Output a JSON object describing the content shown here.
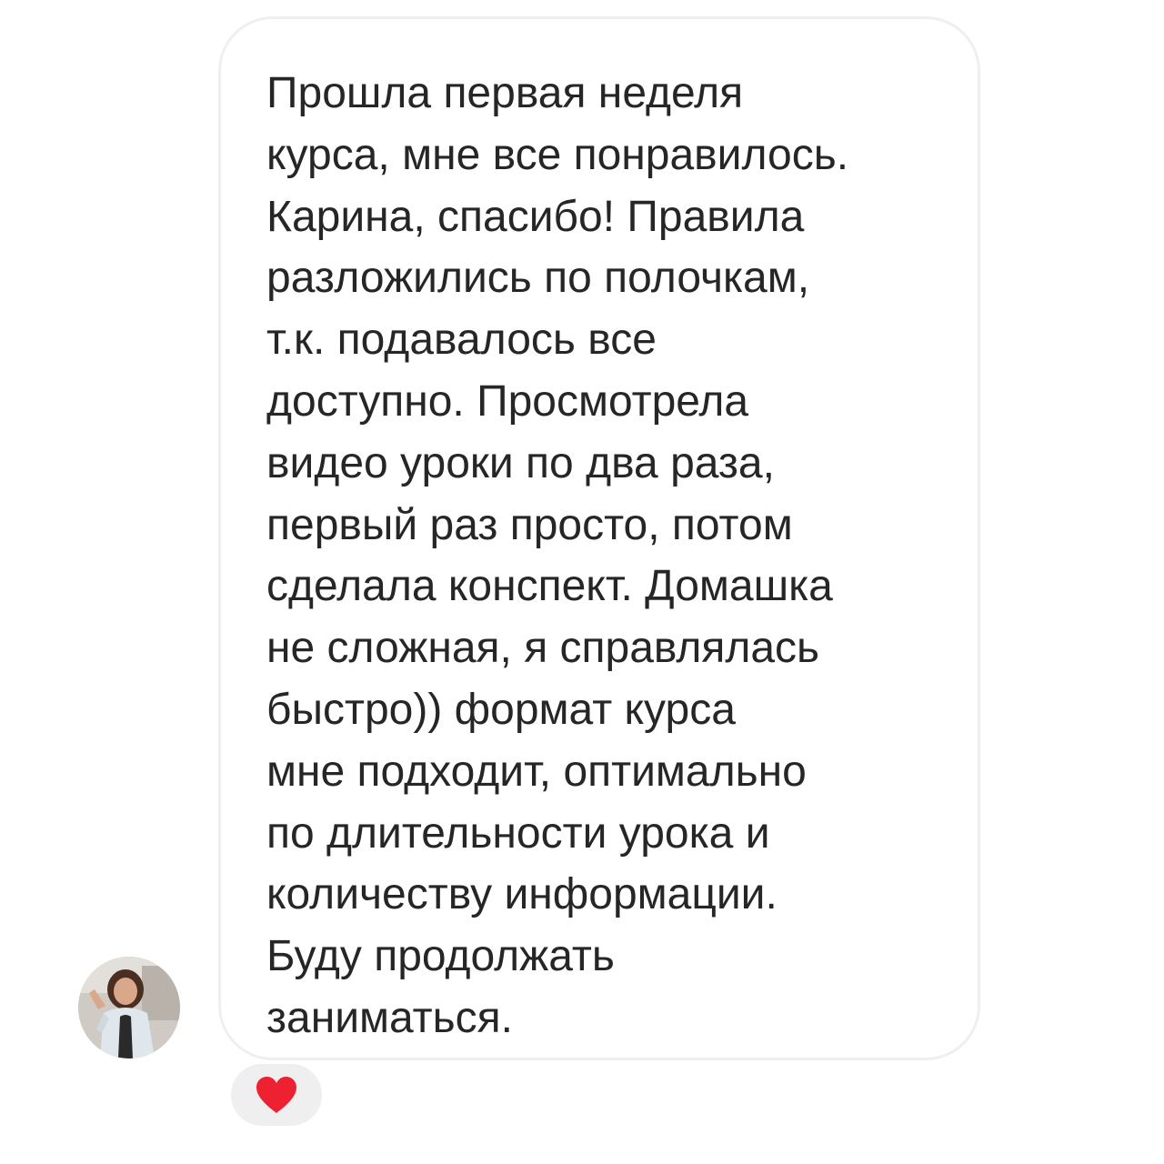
{
  "message": {
    "lines": [
      "Прошла первая неделя",
      "курса, мне все понравилось.",
      "Карина, спасибо! Правила",
      "разложились по полочкам,",
      "т.к. подавалось все",
      "доступно. Просмотрела",
      "видео уроки по два раза,",
      "первый раз просто, потом",
      "сделала конспект. Домашка",
      "не сложная, я справлялась",
      "быстро)) формат курса",
      "мне подходит, оптимально",
      "по длительности урока и",
      "количеству информации.",
      "Буду продолжать",
      "заниматься."
    ]
  },
  "sender": {
    "avatar_icon": "user-avatar-photo"
  },
  "reaction": {
    "icon": "heart-icon",
    "color": "#ed2131"
  },
  "colors": {
    "bubble_border": "#efefef",
    "text": "#262626",
    "reaction_background": "#efefef"
  }
}
